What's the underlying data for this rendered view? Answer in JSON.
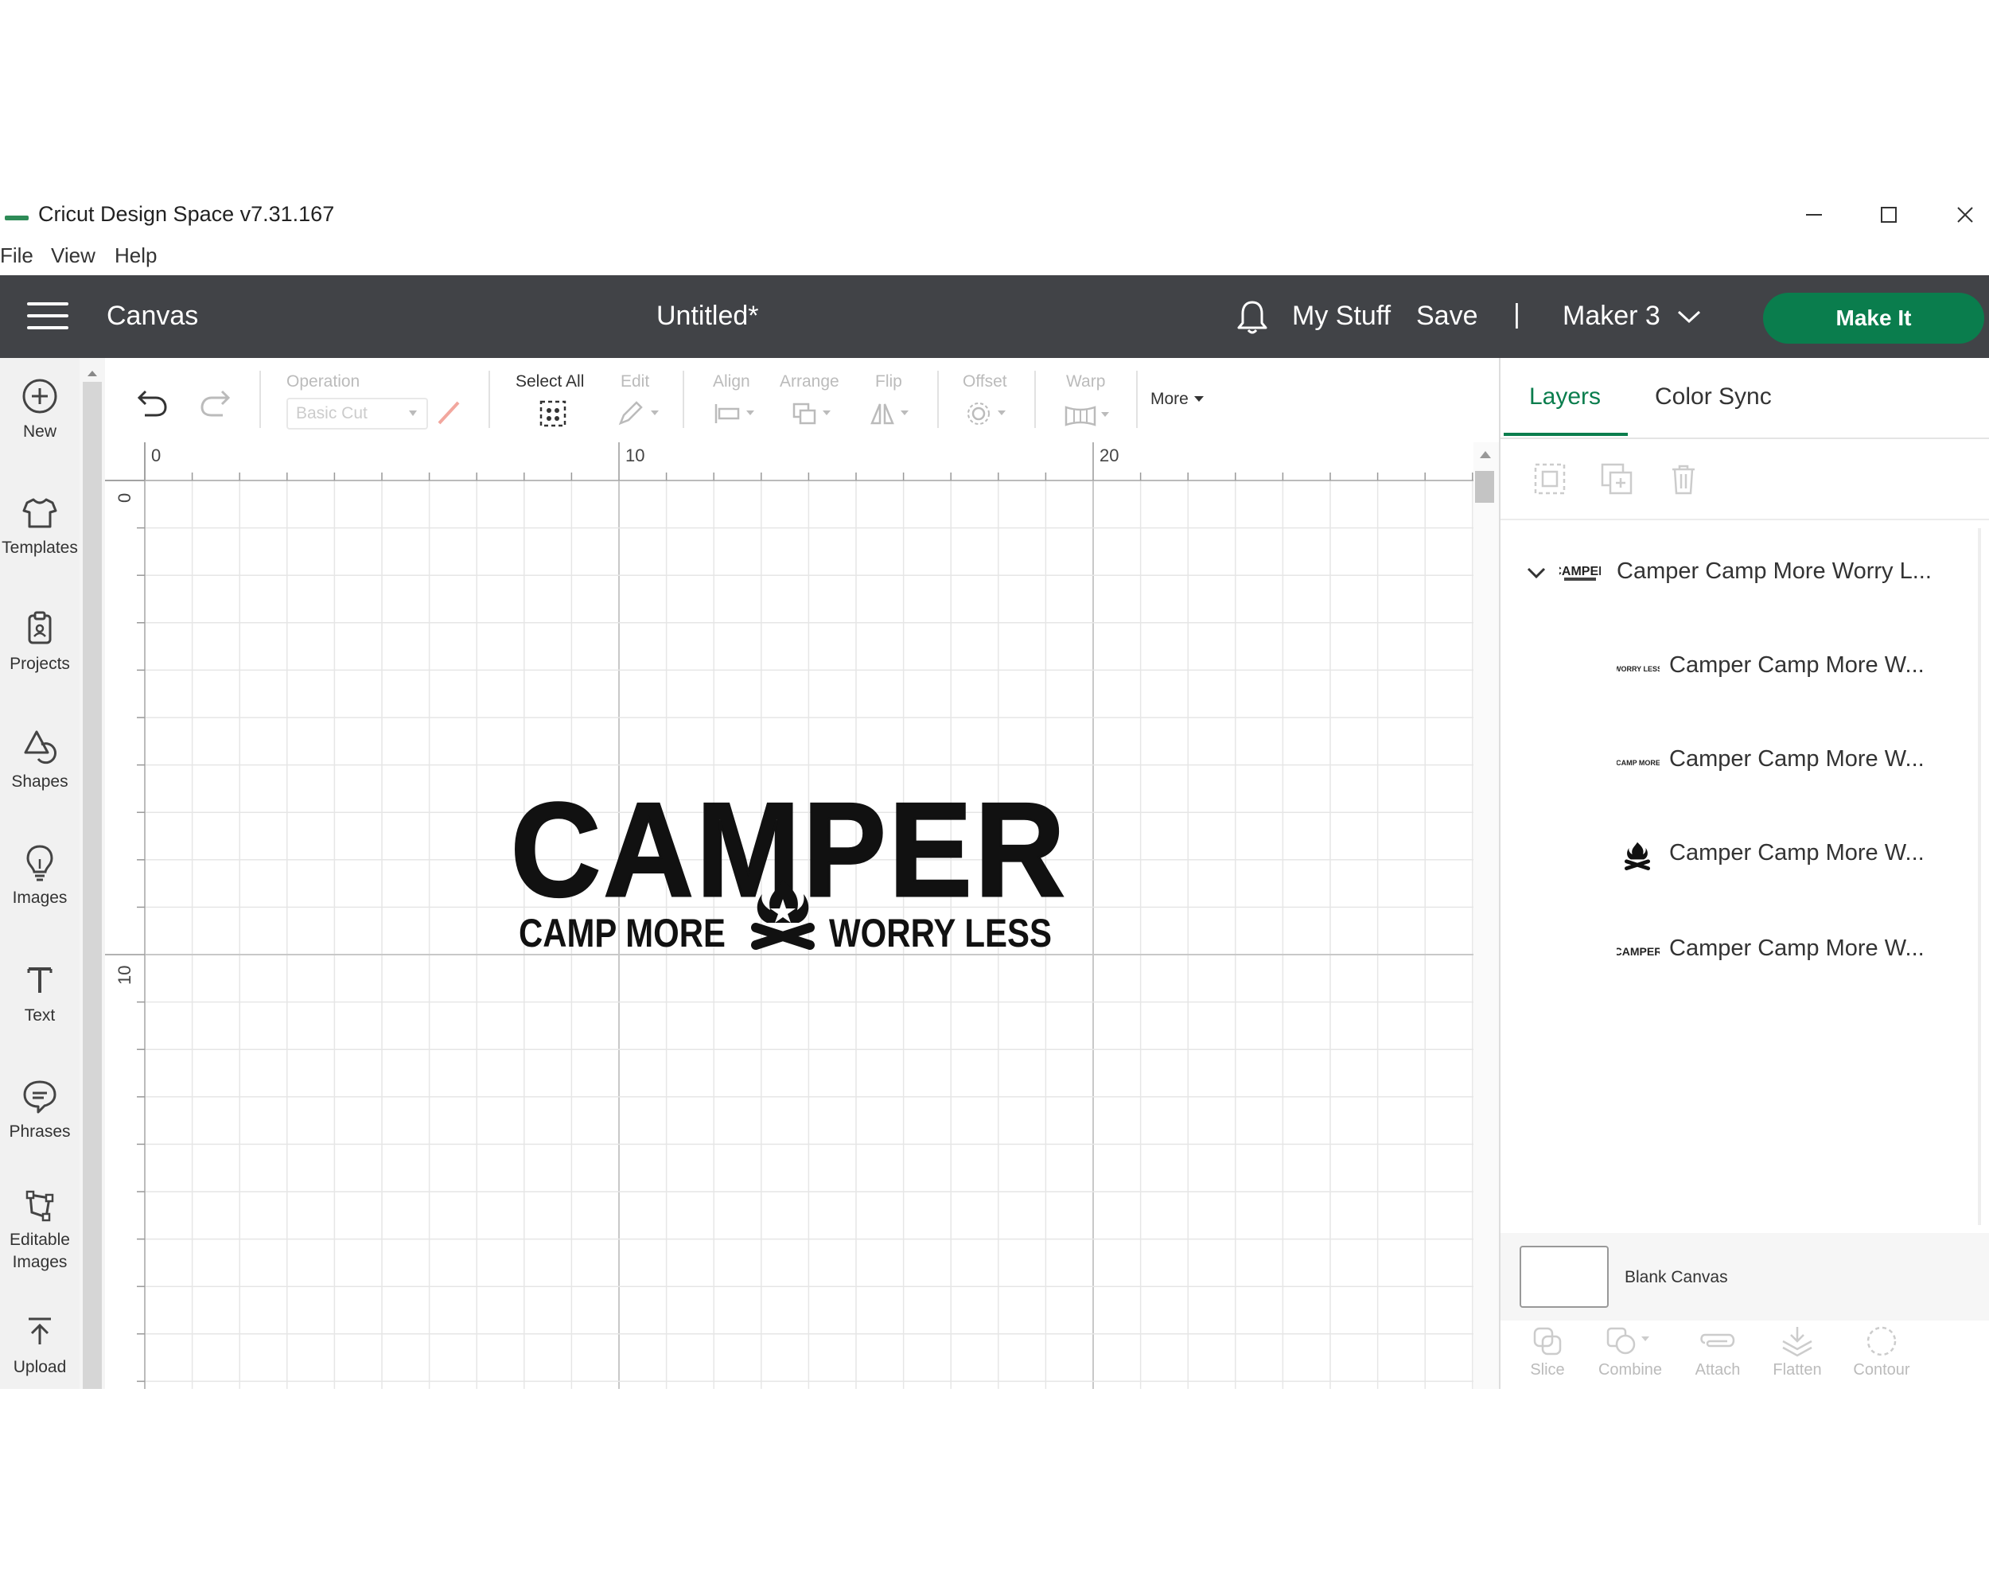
{
  "window": {
    "title": "Cricut Design Space  v7.31.167",
    "menu": [
      "File",
      "View",
      "Help"
    ]
  },
  "header": {
    "section": "Canvas",
    "doc_title": "Untitled*",
    "my_stuff": "My Stuff",
    "save": "Save",
    "separator": "|",
    "machine": "Maker 3",
    "make_it": "Make It",
    "accent": "#0a7d4d",
    "bg": "#414347"
  },
  "sidebar": {
    "items": [
      {
        "label": "New",
        "icon": "plus-circle-icon"
      },
      {
        "label": "Templates",
        "icon": "shirt-icon"
      },
      {
        "label": "Projects",
        "icon": "clipboard-icon"
      },
      {
        "label": "Shapes",
        "icon": "shapes-icon"
      },
      {
        "label": "Images",
        "icon": "lightbulb-icon"
      },
      {
        "label": "Text",
        "icon": "text-icon"
      },
      {
        "label": "Phrases",
        "icon": "speech-bubble-icon"
      },
      {
        "label": "Editable",
        "label2": "Images",
        "icon": "editable-images-icon"
      },
      {
        "label": "Upload",
        "icon": "upload-icon"
      }
    ]
  },
  "toolbar": {
    "operation_label": "Operation",
    "operation_value": "Basic Cut",
    "select_all": "Select All",
    "edit": "Edit",
    "align": "Align",
    "arrange": "Arrange",
    "flip": "Flip",
    "offset": "Offset",
    "warp": "Warp",
    "more": "More"
  },
  "canvas": {
    "ruler_top": [
      "0",
      "10",
      "20"
    ],
    "ruler_left": [
      "0",
      "10"
    ],
    "design": {
      "headline": "CAMPER",
      "left_text": "CAMP MORE",
      "right_text": "WORRY LESS"
    }
  },
  "panel": {
    "tabs": [
      "Layers",
      "Color Sync"
    ],
    "group_name": "Camper Camp More Worry L...",
    "layers": [
      {
        "name": "Camper Camp More W...",
        "thumb": "WORRY LESS"
      },
      {
        "name": "Camper Camp More W...",
        "thumb": "CAMP MORE"
      },
      {
        "name": "Camper Camp More W...",
        "thumb": "campfire"
      },
      {
        "name": "Camper Camp More W...",
        "thumb": "CAMPER"
      }
    ],
    "blank_canvas": "Blank Canvas",
    "bottom_tools": [
      "Slice",
      "Combine",
      "Attach",
      "Flatten",
      "Contour"
    ]
  }
}
